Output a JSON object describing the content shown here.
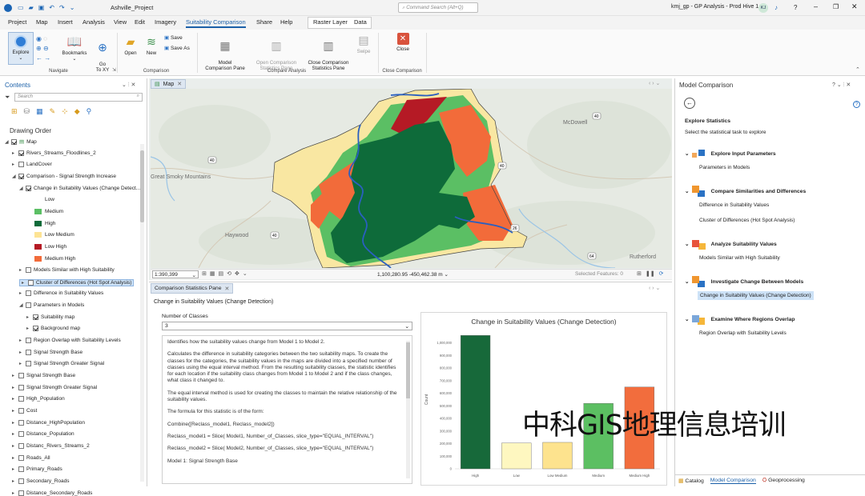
{
  "titlebar": {
    "project_name": "Ashville_Project",
    "search_placeholder": "Command Search (Alt+Q)",
    "right_info": "kmj_gp - GP Analysis - Prod Hive 1",
    "avatar_initials": "KJ"
  },
  "menu": {
    "items": [
      "Project",
      "Map",
      "Insert",
      "Analysis",
      "View",
      "Edit",
      "Imagery",
      "Suitability Comparison",
      "Share",
      "Help"
    ],
    "contextual": [
      "Raster Layer",
      "Data"
    ]
  },
  "ribbon": {
    "explore": "Explore",
    "bookmarks": "Bookmarks",
    "goto": "Go\nTo XY",
    "navigate_group": "Navigate",
    "open": "Open",
    "new": "New",
    "save": "Save",
    "save_as": "Save As",
    "comparison_group": "Comparison",
    "model_pane": "Model\nComparison Pane",
    "open_stats": "Open Comparison\nStatistics Pane",
    "close_stats": "Close Comparison\nStatistics Pane",
    "swipe": "Swipe",
    "compare_group": "Compare Analysis",
    "close": "Close",
    "close_group": "Close Comparison"
  },
  "contents": {
    "title": "Contents",
    "search_placeholder": "Search",
    "drawing_order": "Drawing Order",
    "rows": [
      {
        "label": "Map",
        "indent": 0,
        "cb": true,
        "tri": "◢",
        "map": true
      },
      {
        "label": "Rivers_Streams_Floodlines_2",
        "indent": 1,
        "cb": true,
        "tri": "▸"
      },
      {
        "label": "LandCover",
        "indent": 1,
        "cb": false,
        "tri": "▸"
      },
      {
        "label": "Comparison - Signal Strength Increase",
        "indent": 1,
        "cb": true,
        "tri": "◢"
      },
      {
        "label": "Change in Suitability Values (Change Detect...",
        "indent": 2,
        "cb": true,
        "tri": "◢"
      },
      {
        "label": "Low",
        "indent": 3,
        "swatch": "#ffffff"
      },
      {
        "label": "Medium",
        "indent": 3,
        "swatch": "#5bbf64"
      },
      {
        "label": "High",
        "indent": 3,
        "swatch": "#0e6b3a"
      },
      {
        "label": "Low Medium",
        "indent": 3,
        "swatch": "#fde394"
      },
      {
        "label": "Low High",
        "indent": 3,
        "swatch": "#b51a25"
      },
      {
        "label": "Medium High",
        "indent": 3,
        "swatch": "#f26b3a"
      },
      {
        "label": "Models Similar with High Suitability",
        "indent": 2,
        "cb": false,
        "tri": "▸"
      },
      {
        "label": "Cluster of Differences (Hot Spot Analysis)",
        "indent": 2,
        "cb": false,
        "tri": "▸",
        "selected": true
      },
      {
        "label": "Difference in Suitability Values",
        "indent": 2,
        "cb": false,
        "tri": "▸"
      },
      {
        "label": "Parameters in Models",
        "indent": 2,
        "cb": false,
        "tri": "◢"
      },
      {
        "label": "Suitability map",
        "indent": 3,
        "cb": true,
        "tri": "▸"
      },
      {
        "label": "Background map",
        "indent": 3,
        "cb": true,
        "tri": "▸"
      },
      {
        "label": "Region Overlap with Suitability Levels",
        "indent": 2,
        "cb": false,
        "tri": "▸"
      },
      {
        "label": "Signal Strength Base",
        "indent": 2,
        "cb": false,
        "tri": "▸"
      },
      {
        "label": "Signal Strength Greater Signal",
        "indent": 2,
        "cb": false,
        "tri": "▸"
      },
      {
        "label": "Signal Strength Base",
        "indent": 1,
        "cb": false,
        "tri": "▸"
      },
      {
        "label": "Signal Strength Greater Signal",
        "indent": 1,
        "cb": false,
        "tri": "▸"
      },
      {
        "label": "High_Population",
        "indent": 1,
        "cb": false,
        "tri": "▸"
      },
      {
        "label": "Cost",
        "indent": 1,
        "cb": false,
        "tri": "▸"
      },
      {
        "label": "Distance_HighPopulation",
        "indent": 1,
        "cb": false,
        "tri": "▸"
      },
      {
        "label": "Distance_Population",
        "indent": 1,
        "cb": false,
        "tri": "▸"
      },
      {
        "label": "Distanc_Rivers_Streams_2",
        "indent": 1,
        "cb": false,
        "tri": "▸"
      },
      {
        "label": "Roads_All",
        "indent": 1,
        "cb": false,
        "tri": "▸"
      },
      {
        "label": "Primary_Roads",
        "indent": 1,
        "cb": false,
        "tri": "▸"
      },
      {
        "label": "Secondary_Roads",
        "indent": 1,
        "cb": false,
        "tri": "▸"
      },
      {
        "label": "Distance_Secondary_Roads",
        "indent": 1,
        "cb": false,
        "tri": "▸"
      }
    ]
  },
  "map": {
    "tab": "Map",
    "labels": [
      {
        "text": "McDowell"
      },
      {
        "text": "Great Smoky Mountains"
      },
      {
        "text": "Haywood"
      },
      {
        "text": "Rutherford"
      }
    ],
    "shields": [
      "40",
      "40",
      "40",
      "64",
      "26",
      "40"
    ],
    "scale": "1:390,399",
    "coords": "1,100,280.95 -450,462.38 m",
    "selected": "Selected Features: 0"
  },
  "stats": {
    "tab": "Comparison Statistics Pane",
    "heading": "Change in Suitability Values (Change Detection)",
    "classes_label": "Number of Classes",
    "classes_value": "3",
    "description": [
      "Identifies how the suitability values change from Model 1 to Model 2.",
      "Calculates the difference in suitability categories between the two suitability maps. To create the classes for the categories, the suitability values in the maps are divided into a specified number of classes using the equal interval method. From the resulting suitability classes, the statistic identifies for each location if the suitability class changes from Model 1 to Model 2 and if the class changes, what class it changed to.",
      "The equal interval method is used for creating the classes to maintain the relative relationship of the suitability values.",
      "The formula for this statistic is of the form:",
      "Combine([Reclass_model1, Reclass_model2])",
      "Reclass_model1 = Slice( Model1, Number_of_Classes, slice_type=\"EQUAL_INTERVAL\")",
      "Reclass_model2 = Slice( Model2, Number_of_Classes, slice_type=\"EQUAL_INTERVAL\")",
      "Model 1: Signal Strength Base"
    ]
  },
  "chart_data": {
    "type": "bar",
    "title": "Change in Suitability Values (Change Detection)",
    "ylabel": "Count",
    "xlabel": "",
    "categories": [
      "High",
      "Low",
      "Low Medium",
      "Medium",
      "Medium High"
    ],
    "values": [
      1060000,
      205000,
      210000,
      520000,
      650000
    ],
    "colors": [
      "#17693a",
      "#fef7c0",
      "#fde38e",
      "#5cbf62",
      "#f26d3d"
    ],
    "yticks": [
      "0",
      "100,000",
      "200,000",
      "300,000",
      "400,000",
      "500,000",
      "600,000",
      "700,000",
      "800,000",
      "900,000",
      "1,000,000"
    ],
    "ylim": [
      0,
      1100000
    ],
    "grid": false
  },
  "right": {
    "title": "Model Comparison",
    "section": "Explore Statistics",
    "subtitle": "Select the statistical task to explore",
    "groups": [
      {
        "label": "Explore Input Parameters",
        "items": [
          "Parameters in Models"
        ]
      },
      {
        "label": "Compare Similarities and Differences",
        "items": [
          "Difference in Suitability Values",
          "Cluster of Differences (Hot Spot Analysis)"
        ]
      },
      {
        "label": "Analyze Suitability Values",
        "items": [
          "Models Similar with High Suitability"
        ]
      },
      {
        "label": "Investigate Change Between Models",
        "items": [
          "Change in Suitability Values (Change Detection)"
        ]
      },
      {
        "label": "Examine Where Regions Overlap",
        "items": [
          "Region Overlap with Suitability Levels"
        ]
      }
    ],
    "bottom_tabs": [
      "Catalog",
      "Model Comparison",
      "Geoprocessing"
    ]
  },
  "watermark": "中科GIS地理信息培训"
}
